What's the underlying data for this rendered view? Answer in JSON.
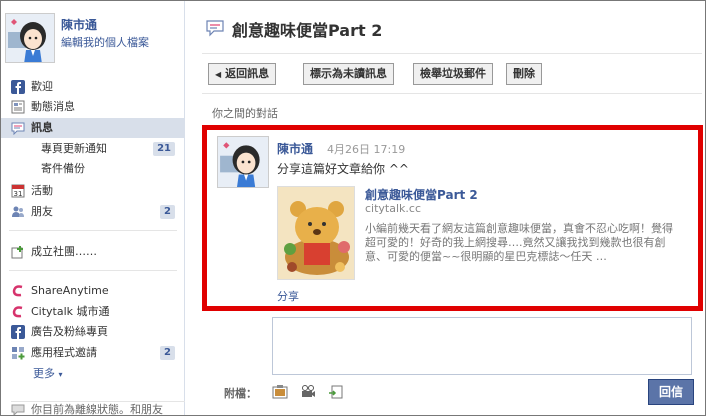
{
  "profile": {
    "name": "陳市通",
    "edit_link": "編輯我的個人檔案"
  },
  "sidebar": {
    "nav": [
      {
        "label": "歡迎"
      },
      {
        "label": "動態消息"
      },
      {
        "label": "訊息"
      }
    ],
    "sub_items": [
      {
        "label": "專頁更新通知",
        "count": "21"
      },
      {
        "label": "寄件備份"
      }
    ],
    "events": "活動",
    "friends": {
      "label": "朋友",
      "count": "2"
    },
    "create_group": "成立社團……",
    "apps": [
      {
        "label": "ShareAnytime"
      },
      {
        "label": "Citytalk 城市通"
      },
      {
        "label": "廣告及粉絲專頁"
      },
      {
        "label": "應用程式邀請",
        "count": "2"
      }
    ],
    "more": "更多",
    "status": "你目前為離線狀態。和朋友"
  },
  "thread": {
    "title": "創意趣味便當Part 2"
  },
  "toolbar": {
    "back": "返回訊息",
    "mark_unread": "標示為未讀訊息",
    "report_spam": "檢舉垃圾郵件",
    "delete": "刪除"
  },
  "conversation_label": "你之間的對話",
  "message": {
    "sender": "陳市通",
    "time": "4月26日 17:19",
    "text": "分享這篇好文章給你 ^^",
    "attachment": {
      "title": "創意趣味便當Part 2",
      "domain": "citytalk.cc",
      "description": "小編前幾天看了網友這篇創意趣味便當，真會不忍心吃啊！覺得超可愛的！好奇的我上網搜尋….竟然又讓我找到幾款也很有創意、可愛的便當~~很明顯的星巴克標誌～任天 …"
    },
    "share": "分享"
  },
  "reply": {
    "attach_label": "附檔：",
    "button": "回信"
  },
  "colors": {
    "link": "#3b5998",
    "highlight_border": "#e00000",
    "nav_active_bg": "#d8dfea",
    "reply_button": "#5b74a8"
  }
}
